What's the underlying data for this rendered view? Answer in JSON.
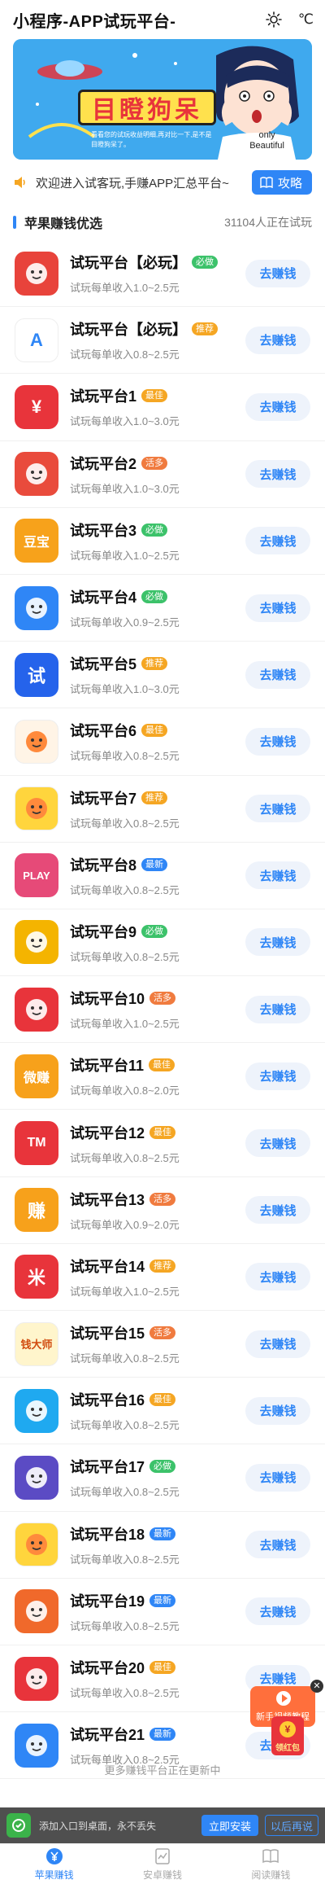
{
  "header": {
    "title": "小程序-APP试玩平台-",
    "celsius": "℃",
    "sun_icon": "sun-icon"
  },
  "banner": {
    "title": "目瞪狗呆",
    "small_text": "看看您的试玩收益明细,再对比一下,是不是目瞪狗呆了。",
    "only_line1": "only",
    "only_line2": "Beautiful"
  },
  "notice": {
    "text": "欢迎进入试客玩,手赚APP汇总平台~",
    "button": "攻略"
  },
  "section": {
    "title": "苹果赚钱优选",
    "count": "31104人正在试玩"
  },
  "platforms": [
    {
      "title": "试玩平台【必玩】",
      "tag": "必做",
      "tag_color": "#3cc26a",
      "sub": "试玩每单收入1.0~2.5元",
      "icon": "red-pacman-icon",
      "icon_bg": "#e8433b",
      "icon_text": "",
      "button": "去赚钱"
    },
    {
      "title": "试玩平台【必玩】",
      "tag": "推荐",
      "tag_color": "#f5a623",
      "sub": "试玩每单收入0.8~2.5元",
      "icon": "blue-a-icon",
      "icon_bg": "#ffffff",
      "icon_text": "A",
      "button": "去赚钱"
    },
    {
      "title": "试玩平台1",
      "tag": "最佳",
      "tag_color": "#f5a623",
      "sub": "试玩每单收入1.0~3.0元",
      "icon": "red-yuan-icon",
      "icon_bg": "#e8343b",
      "icon_text": "¥",
      "button": "去赚钱"
    },
    {
      "title": "试玩平台2",
      "tag": "活多",
      "tag_color": "#f07b3f",
      "sub": "试玩每单收入1.0~3.0元",
      "icon": "cartoon-face-icon",
      "icon_bg": "#e94b3c",
      "icon_text": "",
      "button": "去赚钱"
    },
    {
      "title": "试玩平台3",
      "tag": "必做",
      "tag_color": "#3cc26a",
      "sub": "试玩每单收入1.0~2.5元",
      "icon": "orange-treasure-icon",
      "icon_bg": "#f7a21b",
      "icon_text": "豆宝",
      "button": "去赚钱"
    },
    {
      "title": "试玩平台4",
      "tag": "必做",
      "tag_color": "#3cc26a",
      "sub": "试玩每单收入0.9~2.5元",
      "icon": "rocket-icon",
      "icon_bg": "#2f86f6",
      "icon_text": "",
      "button": "去赚钱"
    },
    {
      "title": "试玩平台5",
      "tag": "推荐",
      "tag_color": "#f5a623",
      "sub": "试玩每单收入1.0~3.0元",
      "icon": "blue-shi-icon",
      "icon_bg": "#2563eb",
      "icon_text": "试",
      "button": "去赚钱"
    },
    {
      "title": "试玩平台6",
      "tag": "最佳",
      "tag_color": "#f5a623",
      "sub": "试玩每单收入0.8~2.5元",
      "icon": "orange-play-icon",
      "icon_bg": "#fff4e6",
      "icon_text": "",
      "button": "去赚钱"
    },
    {
      "title": "试玩平台7",
      "tag": "推荐",
      "tag_color": "#f5a623",
      "sub": "试玩每单收入0.8~2.5元",
      "icon": "yellow-face-icon",
      "icon_bg": "#ffd53d",
      "icon_text": "",
      "button": "去赚钱"
    },
    {
      "title": "试玩平台8",
      "tag": "最新",
      "tag_color": "#2f86f6",
      "sub": "试玩每单收入0.8~2.5元",
      "icon": "play-badge-icon",
      "icon_bg": "#e64a78",
      "icon_text": "PLAY",
      "button": "去赚钱"
    },
    {
      "title": "试玩平台9",
      "tag": "必做",
      "tag_color": "#3cc26a",
      "sub": "试玩每单收入0.8~2.5元",
      "icon": "bee-icon",
      "icon_bg": "#f4b400",
      "icon_text": "",
      "button": "去赚钱"
    },
    {
      "title": "试玩平台10",
      "tag": "活多",
      "tag_color": "#f07b3f",
      "sub": "试玩每单收入1.0~2.5元",
      "icon": "red-monster-icon",
      "icon_bg": "#e8343b",
      "icon_text": "",
      "button": "去赚钱"
    },
    {
      "title": "试玩平台11",
      "tag": "最佳",
      "tag_color": "#f5a623",
      "sub": "试玩每单收入0.8~2.0元",
      "icon": "weizhuan-icon",
      "icon_bg": "#f7a11b",
      "icon_text": "微赚",
      "button": "去赚钱"
    },
    {
      "title": "试玩平台12",
      "tag": "最佳",
      "tag_color": "#f5a623",
      "sub": "试玩每单收入0.8~2.5元",
      "icon": "tm-icon",
      "icon_bg": "#e8343b",
      "icon_text": "TM",
      "button": "去赚钱"
    },
    {
      "title": "试玩平台13",
      "tag": "活多",
      "tag_color": "#f07b3f",
      "sub": "试玩每单收入0.9~2.0元",
      "icon": "zhuan-icon",
      "icon_bg": "#f7a11b",
      "icon_text": "赚",
      "button": "去赚钱"
    },
    {
      "title": "试玩平台14",
      "tag": "推荐",
      "tag_color": "#f5a623",
      "sub": "试玩每单收入1.0~2.5元",
      "icon": "mi-icon",
      "icon_bg": "#e8343b",
      "icon_text": "米",
      "button": "去赚钱"
    },
    {
      "title": "试玩平台15",
      "tag": "活多",
      "tag_color": "#f07b3f",
      "sub": "试玩每单收入0.8~2.5元",
      "icon": "qiandashi-icon",
      "icon_bg": "#fff5cc",
      "icon_text": "钱大师",
      "button": "去赚钱"
    },
    {
      "title": "试玩平台16",
      "tag": "最佳",
      "tag_color": "#f5a623",
      "sub": "试玩每单收入0.8~2.5元",
      "icon": "hand-icon",
      "icon_bg": "#1fa9f0",
      "icon_text": "",
      "button": "去赚钱"
    },
    {
      "title": "试玩平台17",
      "tag": "必做",
      "tag_color": "#3cc26a",
      "sub": "试玩每单收入0.8~2.5元",
      "icon": "cowboy-icon",
      "icon_bg": "#5b4bc4",
      "icon_text": "",
      "button": "去赚钱"
    },
    {
      "title": "试玩平台18",
      "tag": "最新",
      "tag_color": "#2f86f6",
      "sub": "试玩每单收入0.8~2.5元",
      "icon": "peace-hand-icon",
      "icon_bg": "#ffd53d",
      "icon_text": "",
      "button": "去赚钱"
    },
    {
      "title": "试玩平台19",
      "tag": "最新",
      "tag_color": "#2f86f6",
      "sub": "试玩每单收入0.8~2.5元",
      "icon": "monkey-icon",
      "icon_bg": "#f0692b",
      "icon_text": "",
      "button": "去赚钱"
    },
    {
      "title": "试玩平台20",
      "tag": "最佳",
      "tag_color": "#f5a623",
      "sub": "试玩每单收入0.8~2.5元",
      "icon": "lion-icon",
      "icon_bg": "#e8343b",
      "icon_text": "",
      "button": "去赚钱"
    },
    {
      "title": "试玩平台21",
      "tag": "最新",
      "tag_color": "#2f86f6",
      "sub": "试玩每单收入0.8~2.5元",
      "icon": "squirrel-icon",
      "icon_bg": "#2f86f6",
      "icon_text": "",
      "button": "去赚钱"
    }
  ],
  "more_note": "更多赚钱平台正在更新中",
  "float_video": {
    "label": "新手视频教程",
    "close": "✕"
  },
  "float_redpack": {
    "label": "领红包",
    "coin": "¥"
  },
  "install_bar": {
    "text": "添加入口到桌面，永不丢失",
    "install": "立即安装",
    "later": "以后再说"
  },
  "tabs": [
    {
      "label": "苹果赚钱",
      "active": true,
      "icon": "yuan-circle-icon"
    },
    {
      "label": "安卓赚钱",
      "active": false,
      "icon": "chart-doc-icon"
    },
    {
      "label": "阅读赚钱",
      "active": false,
      "icon": "book-icon"
    }
  ],
  "colors": {
    "accent": "#2f86f6",
    "button_bg": "#eef3fb"
  }
}
